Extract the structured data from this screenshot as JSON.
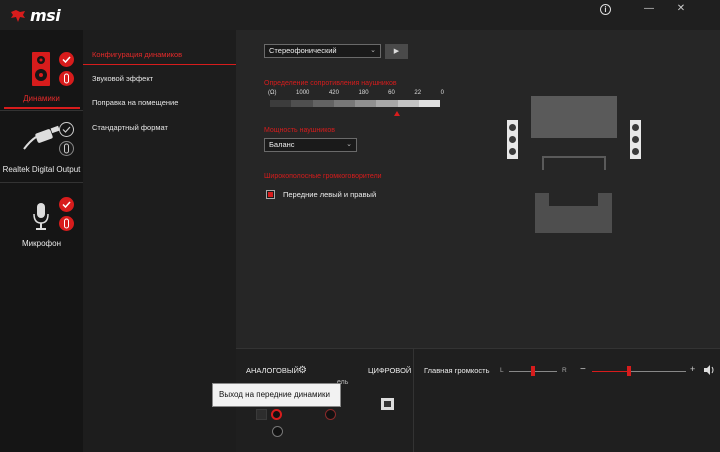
{
  "app": {
    "brand": "msi"
  },
  "window": {
    "info_icon": "info-icon",
    "minimize_glyph": "—",
    "close_glyph": "✕",
    "info_glyph": "i"
  },
  "devices": [
    {
      "label": "Динамики",
      "icon": "speaker-icon",
      "active": true
    },
    {
      "label": "Realtek Digital Output",
      "icon": "optical-cable-icon",
      "active": false
    },
    {
      "label": "Микрофон",
      "icon": "microphone-icon",
      "active": false
    }
  ],
  "menu": {
    "items": [
      {
        "label": "Конфигурация динамиков",
        "active": true
      },
      {
        "label": "Звуковой эффект",
        "active": false
      },
      {
        "label": "Поправка на помещение",
        "active": false
      },
      {
        "label": "Стандартный формат",
        "active": false
      }
    ]
  },
  "config": {
    "speaker_mode": "Стереофонический",
    "play_glyph": "▶",
    "impedance_label": "Определение сопротивления наушников",
    "impedance_scale": [
      "(Ω)",
      "1000",
      "420",
      "180",
      "60",
      "22",
      "0"
    ],
    "power_label": "Мощность наушников",
    "power_value": "Баланс",
    "wideband_label": "Широкополосные громкоговорители",
    "front_lr_label": "Передние левый и правый",
    "front_lr_checked": true
  },
  "bottom": {
    "analog_label": "АНАЛОГОВЫЙ",
    "digital_label": "ЦИФРОВОЙ",
    "partial_text": "ель",
    "tooltip": "Выход на передние динамики",
    "main_volume_label": "Главная громкость",
    "balance_left": "L",
    "balance_right": "R",
    "volume_minus": "−",
    "volume_plus": "+",
    "volume_icon": "speaker-volume-icon",
    "gear_glyph": "⚙"
  },
  "colors": {
    "accent": "#d71c1c",
    "background": "#262626",
    "sidebar": "#151515"
  }
}
